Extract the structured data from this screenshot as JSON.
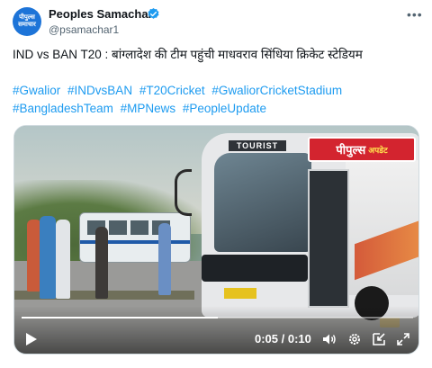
{
  "account": {
    "name": "Peoples Samachar",
    "handle": "@psamachar1",
    "avatar_text_line1": "पीपुल्स",
    "avatar_text_line2": "समाचार",
    "verified_color": "#1d9bf0"
  },
  "menu_icon": "more-horizontal-icon",
  "post": {
    "text": "IND vs BAN T20 : बांग्लादेश की टीम पहुंची माधवराव सिंधिया क्रिकेट स्टेडियम",
    "hashtags": [
      "#Gwalior",
      "#INDvsBAN",
      "#T20Cricket",
      "#GwaliorCricketStadium",
      "#BangladeshTeam",
      "#MPNews",
      "#PeopleUpdate"
    ],
    "hashtag_color": "#1d9bf0"
  },
  "video": {
    "badge_text_main": "पीपुल्स",
    "badge_text_sub": "अपडेट",
    "bus_sign": "TOURIST",
    "current_time": "0:05",
    "duration": "0:10",
    "time_separator": " / ",
    "progress": 0.5,
    "icons": [
      "play-icon",
      "volume-icon",
      "settings-icon",
      "exit-fullscreen-icon",
      "fullscreen-icon"
    ]
  }
}
